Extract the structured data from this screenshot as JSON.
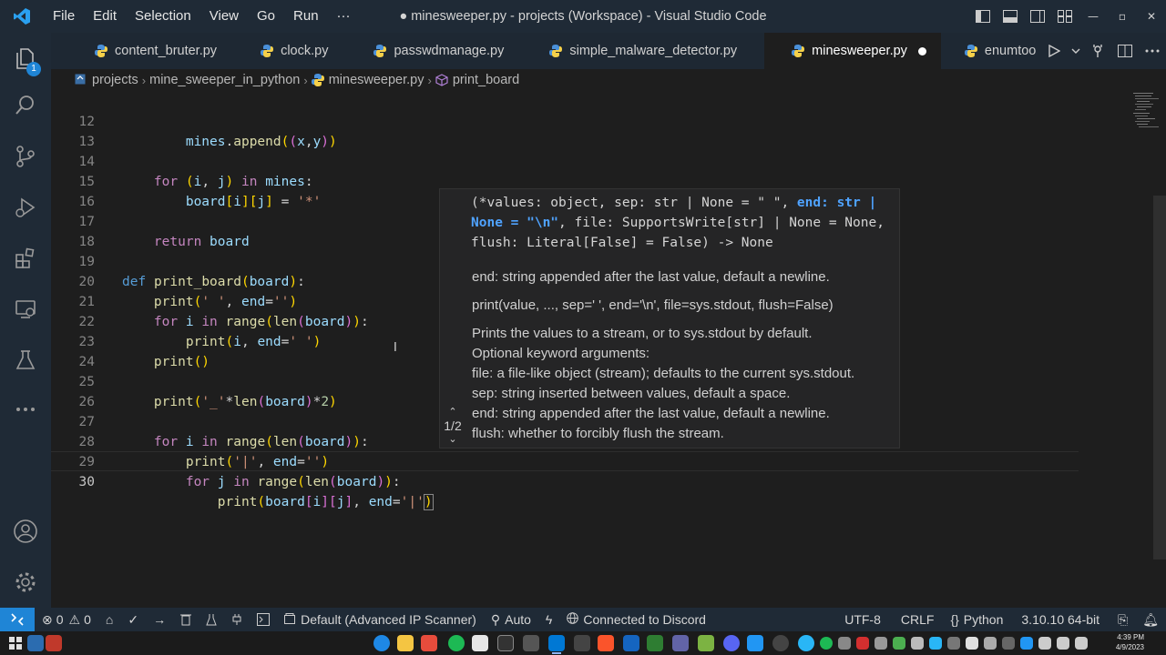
{
  "titlebar": {
    "menu": [
      "File",
      "Edit",
      "Selection",
      "View",
      "Go",
      "Run",
      "···"
    ],
    "title": "● minesweeper.py - projects (Workspace) - Visual Studio Code",
    "window_buttons": [
      "—",
      "▫",
      "✕"
    ]
  },
  "activitybar": {
    "explorer_badge": "1"
  },
  "tabs": [
    {
      "label": "content_bruter.py",
      "active": false
    },
    {
      "label": "clock.py",
      "active": false
    },
    {
      "label": "passwdmanage.py",
      "active": false
    },
    {
      "label": "simple_malware_detector.py",
      "active": false
    },
    {
      "label": "minesweeper.py",
      "active": true,
      "dirty": true
    },
    {
      "label": "enumtoo",
      "active": false
    }
  ],
  "breadcrumb": [
    "projects",
    "mine_sweeper_in_python",
    "minesweeper.py",
    "print_board"
  ],
  "editor": {
    "line_numbers": [
      "12",
      "13",
      "14",
      "15",
      "16",
      "17",
      "18",
      "19",
      "20",
      "21",
      "22",
      "23",
      "24",
      "25",
      "26",
      "27",
      "28",
      "29",
      "30"
    ],
    "current_line": "30"
  },
  "hover": {
    "sig_part1": "(*values: object, sep: str | None = \" \", ",
    "sig_highlight": "end: str | None = \"\\n\"",
    "sig_part2": ", file: SupportsWrite[str] | None = None, flush: Literal[False] = False) -> None",
    "param_doc": "end:   string appended after the last value, default a newline.",
    "signature_doc": "print(value, ..., sep=' ', end='\\n', file=sys.stdout, flush=False)",
    "doc_lines": [
      "Prints the values to a stream, or to sys.stdout by default.",
      "Optional keyword arguments:",
      "file: a file-like object (stream); defaults to the current sys.stdout.",
      "sep: string inserted between values, default a space.",
      "end: string appended after the last value, default a newline.",
      "flush: whether to forcibly flush the stream."
    ],
    "pager": "1/2"
  },
  "statusbar": {
    "errors": "0",
    "warnings": "0",
    "interpreter_env": "Default (Advanced IP Scanner)",
    "auto": "Auto",
    "discord": "Connected to Discord",
    "encoding": "UTF-8",
    "eol": "CRLF",
    "language": "Python",
    "version": "3.10.10 64-bit"
  },
  "taskbar": {
    "time": "4:39 PM",
    "date": "4/9/2023"
  },
  "colors": {
    "accent": "#1f85d6",
    "titlebar": "#1f2a36",
    "editor_bg": "#1e1e1e",
    "hover_bg": "#252526"
  }
}
